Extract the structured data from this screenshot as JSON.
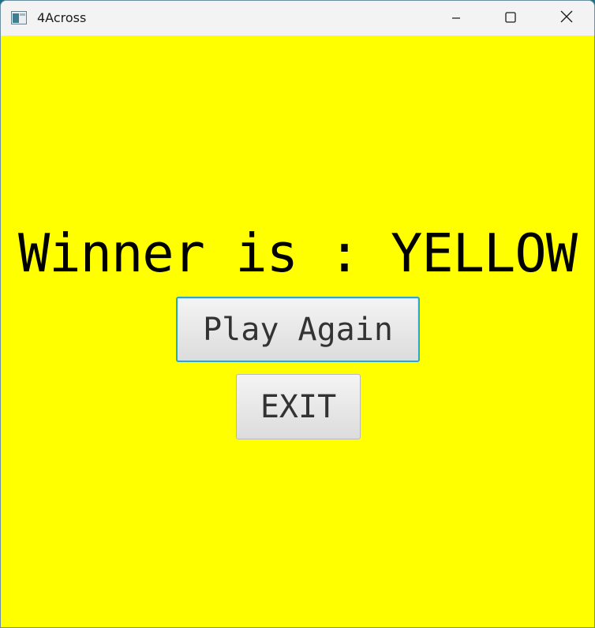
{
  "window": {
    "title": "4Across",
    "icon": "java-app-icon",
    "background_color": "#ffff00"
  },
  "titlebar": {
    "minimize_icon": "minimize-icon",
    "maximize_icon": "maximize-icon",
    "close_icon": "close-icon"
  },
  "main": {
    "winner_text": "Winner is : YELLOW",
    "play_again_label": "Play Again",
    "exit_label": "EXIT",
    "focus_color": "#2ea6c8"
  }
}
